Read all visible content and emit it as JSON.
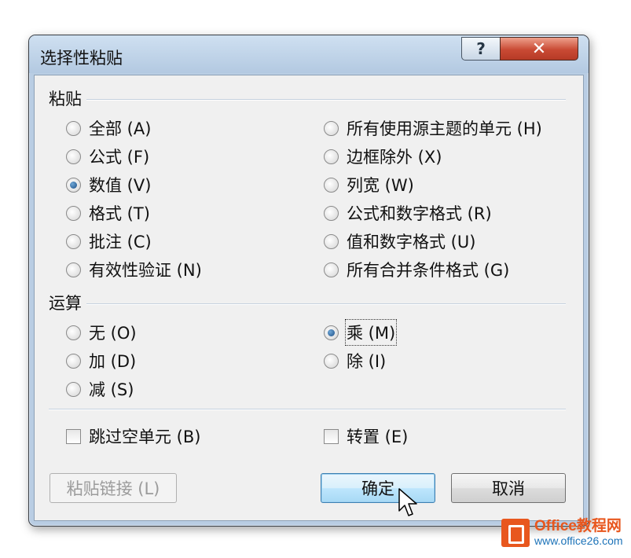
{
  "dialog": {
    "title": "选择性粘贴",
    "help_glyph": "?",
    "close_glyph": "✕"
  },
  "paste": {
    "label": "粘贴",
    "left": [
      {
        "label": "全部 (A)",
        "checked": false
      },
      {
        "label": "公式 (F)",
        "checked": false
      },
      {
        "label": "数值 (V)",
        "checked": true
      },
      {
        "label": "格式 (T)",
        "checked": false
      },
      {
        "label": "批注 (C)",
        "checked": false
      },
      {
        "label": "有效性验证 (N)",
        "checked": false
      }
    ],
    "right": [
      {
        "label": "所有使用源主题的单元 (H)",
        "checked": false
      },
      {
        "label": "边框除外 (X)",
        "checked": false
      },
      {
        "label": "列宽 (W)",
        "checked": false
      },
      {
        "label": "公式和数字格式 (R)",
        "checked": false
      },
      {
        "label": "值和数字格式 (U)",
        "checked": false
      },
      {
        "label": "所有合并条件格式 (G)",
        "checked": false
      }
    ]
  },
  "operation": {
    "label": "运算",
    "left": [
      {
        "label": "无 (O)",
        "checked": false
      },
      {
        "label": "加 (D)",
        "checked": false
      },
      {
        "label": "减 (S)",
        "checked": false
      }
    ],
    "right": [
      {
        "label": "乘 (M)",
        "checked": true
      },
      {
        "label": "除 (I)",
        "checked": false
      }
    ]
  },
  "checkboxes": {
    "skip_blanks": "跳过空单元 (B)",
    "transpose": "转置 (E)"
  },
  "buttons": {
    "paste_link": "粘贴链接 (L)",
    "ok": "确定",
    "cancel": "取消"
  },
  "watermark": {
    "line1": "Office教程网",
    "line2": "www.office26.com"
  },
  "colors": {
    "accent": "#1c4e86",
    "close": "#c94a34",
    "logo": "#e8571e"
  }
}
